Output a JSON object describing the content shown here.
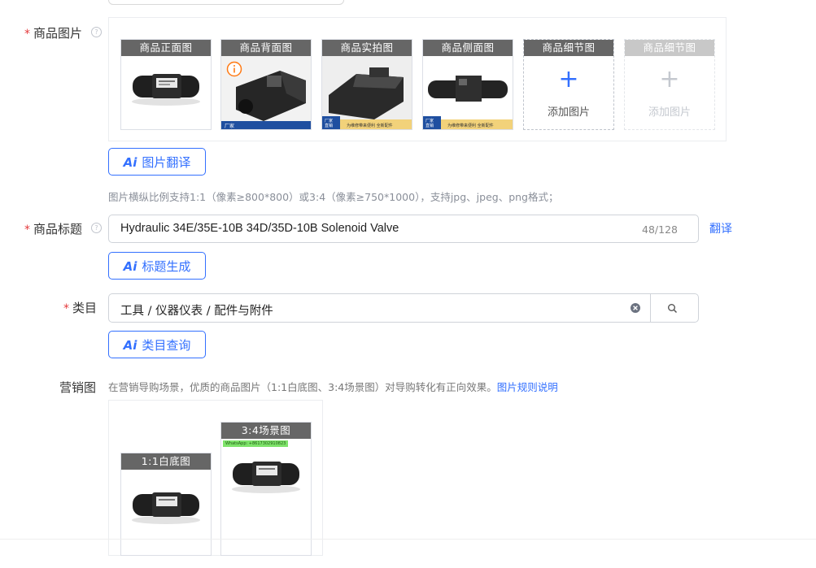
{
  "product_images": {
    "label": "商品图片",
    "required_mark": "*",
    "help_icon": "question-circle-icon",
    "cards": [
      {
        "title": "商品正面图",
        "banner": "",
        "caption": ""
      },
      {
        "title": "商品背面图",
        "banner": "厂家",
        "caption": ""
      },
      {
        "title": "商品实拍图",
        "banner": "厂家\n直销",
        "caption": "为维修带来便利 全新配件"
      },
      {
        "title": "商品侧面图",
        "banner": "厂家\n直销",
        "caption": "为维修带来便利 全新配件"
      },
      {
        "title": "商品细节图",
        "add_label": "添加图片"
      },
      {
        "title": "商品细节图",
        "add_label": "添加图片"
      }
    ],
    "warning_icon": "info-circle-icon",
    "ai_button": {
      "icon_text": "Ai",
      "label": "图片翻译"
    },
    "hint": "图片横纵比例支持1:1（像素≥800*800）或3:4（像素≥750*1000），支持jpg、jpeg、png格式；"
  },
  "title_field": {
    "label": "商品标题",
    "required_mark": "*",
    "value": "Hydraulic 34E/35E-10B 34D/35D-10B Solenoid Valve",
    "counter": "48/128",
    "translate_link": "翻译",
    "ai_button": {
      "icon_text": "Ai",
      "label": "标题生成"
    }
  },
  "category_field": {
    "label": "类目",
    "required_mark": "*",
    "value": "工具 / 仪器仪表 / 配件与附件",
    "clear_icon": "clear-circle-icon",
    "search_icon": "search-icon",
    "ai_button": {
      "icon_text": "Ai",
      "label": "类目查询"
    }
  },
  "marketing": {
    "label": "营销图",
    "hint": "在营销导购场景，优质的商品图片（1:1白底图、3:4场景图）对导购转化有正向效果。",
    "rules_link": "图片规则说明",
    "cards": [
      {
        "title": "1:1白底图"
      },
      {
        "title": "3:4场景图",
        "whatsapp_tag": "WhatsApp: +8617302910823"
      }
    ]
  },
  "colors": {
    "accent": "#3370ff",
    "required": "#e4393c",
    "card_title_bg": "#666666"
  }
}
